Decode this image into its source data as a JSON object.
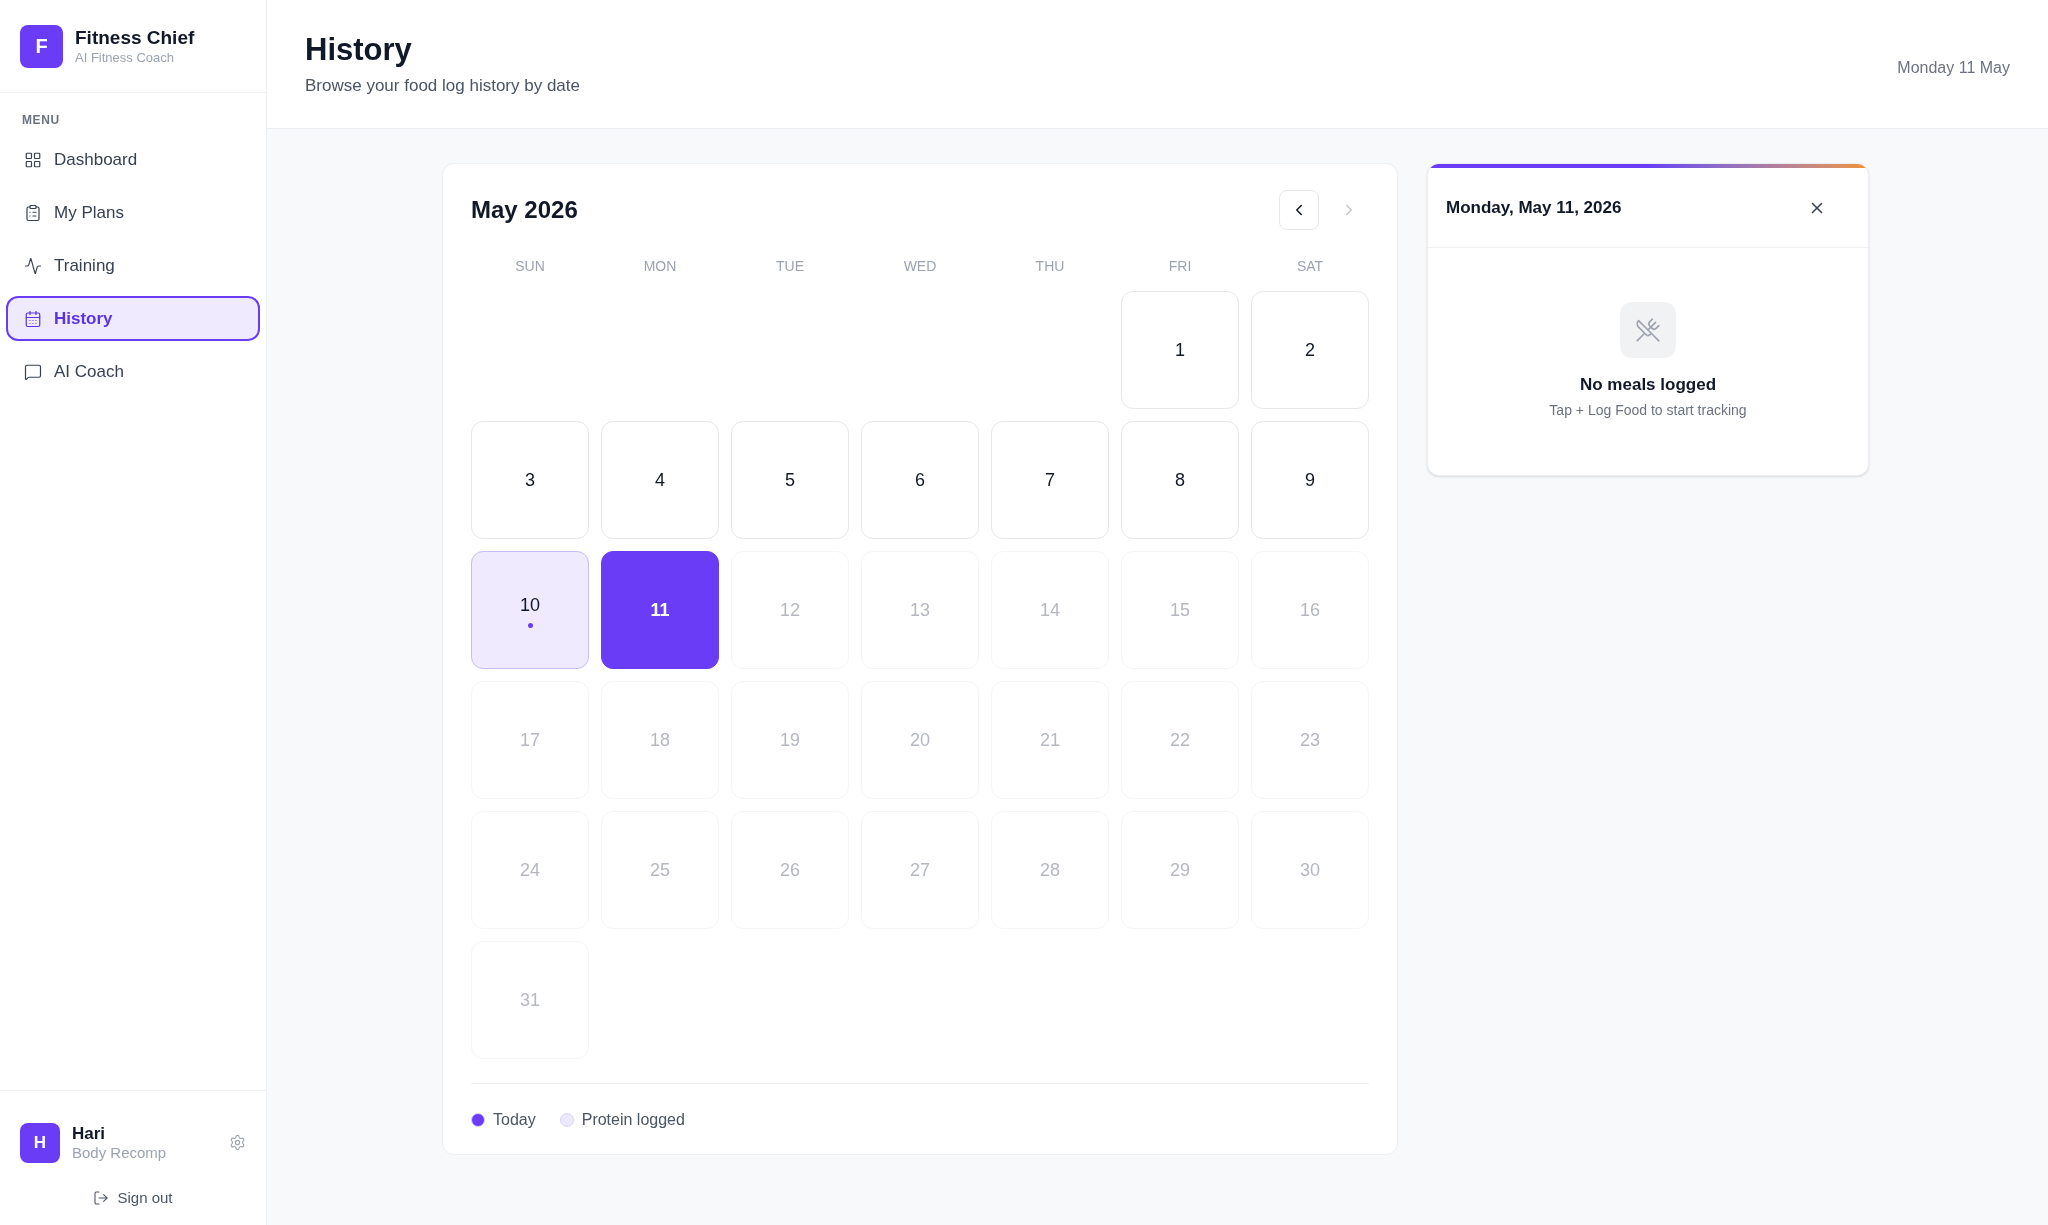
{
  "brand": {
    "logo_letter": "F",
    "name": "Fitness Chief",
    "tagline": "AI Fitness Coach"
  },
  "menu": {
    "heading": "MENU",
    "items": [
      {
        "label": "Dashboard",
        "kind": "dashboard",
        "selected": false
      },
      {
        "label": "My Plans",
        "kind": "plans",
        "selected": false
      },
      {
        "label": "Training",
        "kind": "training",
        "selected": false
      },
      {
        "label": "History",
        "kind": "history",
        "selected": true
      },
      {
        "label": "AI Coach",
        "kind": "coach",
        "selected": false
      }
    ]
  },
  "user": {
    "initial": "H",
    "name": "Hari",
    "plan": "Body Recomp",
    "sign_out": "Sign out"
  },
  "header": {
    "title": "History",
    "subtitle": "Browse your food log history by date",
    "date": "Monday 11 May"
  },
  "calendar": {
    "month": "May 2026",
    "prev_disabled": false,
    "next_disabled": true,
    "weekdays": [
      "SUN",
      "MON",
      "TUE",
      "WED",
      "THU",
      "FRI",
      "SAT"
    ],
    "days": [
      {
        "kind": "blank"
      },
      {
        "kind": "blank"
      },
      {
        "kind": "blank"
      },
      {
        "kind": "blank"
      },
      {
        "kind": "blank"
      },
      {
        "label": "1",
        "kind": "past"
      },
      {
        "label": "2",
        "kind": "past"
      },
      {
        "label": "3",
        "kind": "past"
      },
      {
        "label": "4",
        "kind": "past"
      },
      {
        "label": "5",
        "kind": "past"
      },
      {
        "label": "6",
        "kind": "past"
      },
      {
        "label": "7",
        "kind": "past"
      },
      {
        "label": "8",
        "kind": "past"
      },
      {
        "label": "9",
        "kind": "past"
      },
      {
        "label": "10",
        "kind": "logged"
      },
      {
        "label": "11",
        "kind": "today"
      },
      {
        "label": "12",
        "kind": "future"
      },
      {
        "label": "13",
        "kind": "future"
      },
      {
        "label": "14",
        "kind": "future"
      },
      {
        "label": "15",
        "kind": "future"
      },
      {
        "label": "16",
        "kind": "future"
      },
      {
        "label": "17",
        "kind": "future"
      },
      {
        "label": "18",
        "kind": "future"
      },
      {
        "label": "19",
        "kind": "future"
      },
      {
        "label": "20",
        "kind": "future"
      },
      {
        "label": "21",
        "kind": "future"
      },
      {
        "label": "22",
        "kind": "future"
      },
      {
        "label": "23",
        "kind": "future"
      },
      {
        "label": "24",
        "kind": "future"
      },
      {
        "label": "25",
        "kind": "future"
      },
      {
        "label": "26",
        "kind": "future"
      },
      {
        "label": "27",
        "kind": "future"
      },
      {
        "label": "28",
        "kind": "future"
      },
      {
        "label": "29",
        "kind": "future"
      },
      {
        "label": "30",
        "kind": "future"
      },
      {
        "label": "31",
        "kind": "future"
      }
    ],
    "legend": [
      {
        "label": "Today",
        "color": "#6a3cf5"
      },
      {
        "label": "Protein logged",
        "color": "#ece8fd"
      }
    ]
  },
  "detail": {
    "date": "Monday, May 11, 2026",
    "empty_title": "No meals logged",
    "empty_hint": "Tap + Log Food to start tracking"
  }
}
